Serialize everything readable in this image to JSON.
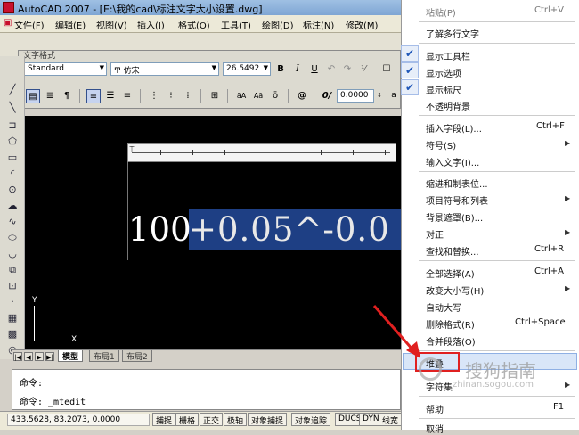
{
  "window": {
    "title": "AutoCAD 2007 - [E:\\我的cad\\标注文字大小设置.dwg]"
  },
  "menubar": {
    "items": [
      "文件(F)",
      "编辑(E)",
      "视图(V)",
      "插入(I)",
      "格式(O)",
      "工具(T)",
      "绘图(D)",
      "标注(N)",
      "修改(M)"
    ]
  },
  "text_format": {
    "caption": "文字格式",
    "style_value": "Standard",
    "font_value": "仿宋",
    "height_value": "26.5492",
    "bold_label": "B",
    "italic_label": "I",
    "underline_label": "U",
    "oblique_value": "0.0000",
    "symbol_label": "@",
    "oblique_label": "0/"
  },
  "editor": {
    "plain_text": "100",
    "selected_text": "+0.05^-0.0"
  },
  "ucs": {
    "x_label": "X",
    "y_label": "Y"
  },
  "layout_tabs": {
    "nav": [
      "|◀",
      "◀",
      "▶",
      "▶|"
    ],
    "tabs": [
      "模型",
      "布局1",
      "布局2"
    ]
  },
  "command": {
    "lines": [
      "命令:",
      "命令: _mtedit"
    ]
  },
  "statusbar": {
    "coords": "433.5628, 83.2073, 0.0000",
    "buttons": [
      "捕捉",
      "栅格",
      "正交",
      "极轴",
      "对象捕捉",
      "对象追踪",
      "DUCS",
      "DYN",
      "线宽"
    ]
  },
  "context_menu": {
    "paste": {
      "label": "粘贴(P)",
      "shortcut": "Ctrl+V"
    },
    "learn": "了解多行文字",
    "show_toolbar": "显示工具栏",
    "show_options": "显示选项",
    "show_ruler": "显示标尺",
    "opaque_bg": "不透明背景",
    "insert_field": {
      "label": "插入字段(L)...",
      "shortcut": "Ctrl+F"
    },
    "symbol": "符号(S)",
    "input_text": "输入文字(I)...",
    "indent_tabs": "缩进和制表位...",
    "bullets": "项目符号和列表",
    "bg_mask": "背景遮罩(B)...",
    "justify": "对正",
    "find_replace": {
      "label": "查找和替换...",
      "shortcut": "Ctrl+R"
    },
    "select_all": {
      "label": "全部选择(A)",
      "shortcut": "Ctrl+A"
    },
    "change_case": "改变大小写(H)",
    "autocaps": "自动大写",
    "remove_format": {
      "label": "删除格式(R)",
      "shortcut": "Ctrl+Space"
    },
    "combine_para": "合并段落(O)",
    "stack": "堆叠",
    "charset": "字符集",
    "help": {
      "label": "帮助",
      "shortcut": "F1"
    },
    "cancel": "取消"
  },
  "watermark": {
    "text": "搜狗指南",
    "url": "zhinan.sogou.com"
  },
  "colors": {
    "selection": "#1e3f84",
    "highlight_box": "#e02020",
    "check": "#1f57b8"
  }
}
